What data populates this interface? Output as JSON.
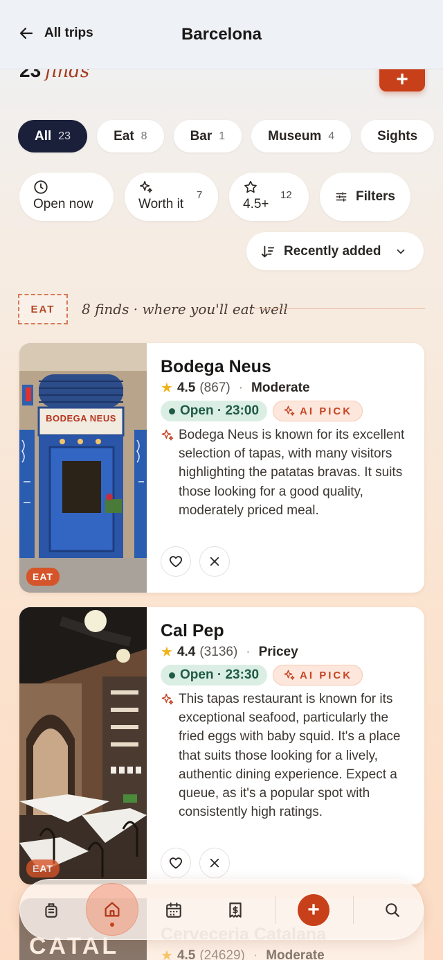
{
  "header": {
    "back_label": "All trips",
    "title": "Barcelona"
  },
  "summary": {
    "count": "23",
    "finds_label": "finds",
    "add_label": "+"
  },
  "categories": [
    {
      "label": "All",
      "count": "23",
      "active": true
    },
    {
      "label": "Eat",
      "count": "8"
    },
    {
      "label": "Bar",
      "count": "1"
    },
    {
      "label": "Museum",
      "count": "4"
    },
    {
      "label": "Sights",
      "count": ""
    }
  ],
  "filters": {
    "open_now": "Open now",
    "worth_it": "Worth it",
    "worth_it_count": "7",
    "rating": "4.5+",
    "rating_count": "12",
    "filters": "Filters"
  },
  "sort": {
    "label": "Recently added"
  },
  "section": {
    "tag": "EAT",
    "text": "8 finds · where you'll eat well"
  },
  "places": [
    {
      "name": "Bodega Neus",
      "rating": "4.5",
      "reviews": "(867)",
      "price": "Moderate",
      "open": "Open · 23:00",
      "ai_pick": "AI PICK",
      "sign": "BODEGA NEUS",
      "badge": "EAT",
      "description": "Bodega Neus is known for its excellent selection of tapas, with many visitors highlighting the patatas bravas. It suits those looking for a good quality, moderately priced meal."
    },
    {
      "name": "Cal Pep",
      "rating": "4.4",
      "reviews": "(3136)",
      "price": "Pricey",
      "open": "Open · 23:30",
      "ai_pick": "AI PICK",
      "badge": "EAT",
      "description": "This tapas restaurant is known for its exceptional seafood, particularly the fried eggs with baby squid. It's a place that suits those looking for a lively, authentic dining experience. Expect a queue, as it's a popular spot with consistently high ratings."
    },
    {
      "name": "Cerveceria Catalana",
      "rating": "4.5",
      "reviews": "(24629)",
      "price": "Moderate",
      "sign": "CATAL"
    }
  ],
  "nav": {
    "items": [
      "luggage-icon",
      "home-icon",
      "calendar-icon",
      "receipt-icon",
      "add-icon",
      "search-icon"
    ],
    "add_label": "+"
  },
  "colors": {
    "accent": "#c8401a",
    "dark_chip": "#1a1f3a",
    "open_green": "#1f5b45"
  }
}
